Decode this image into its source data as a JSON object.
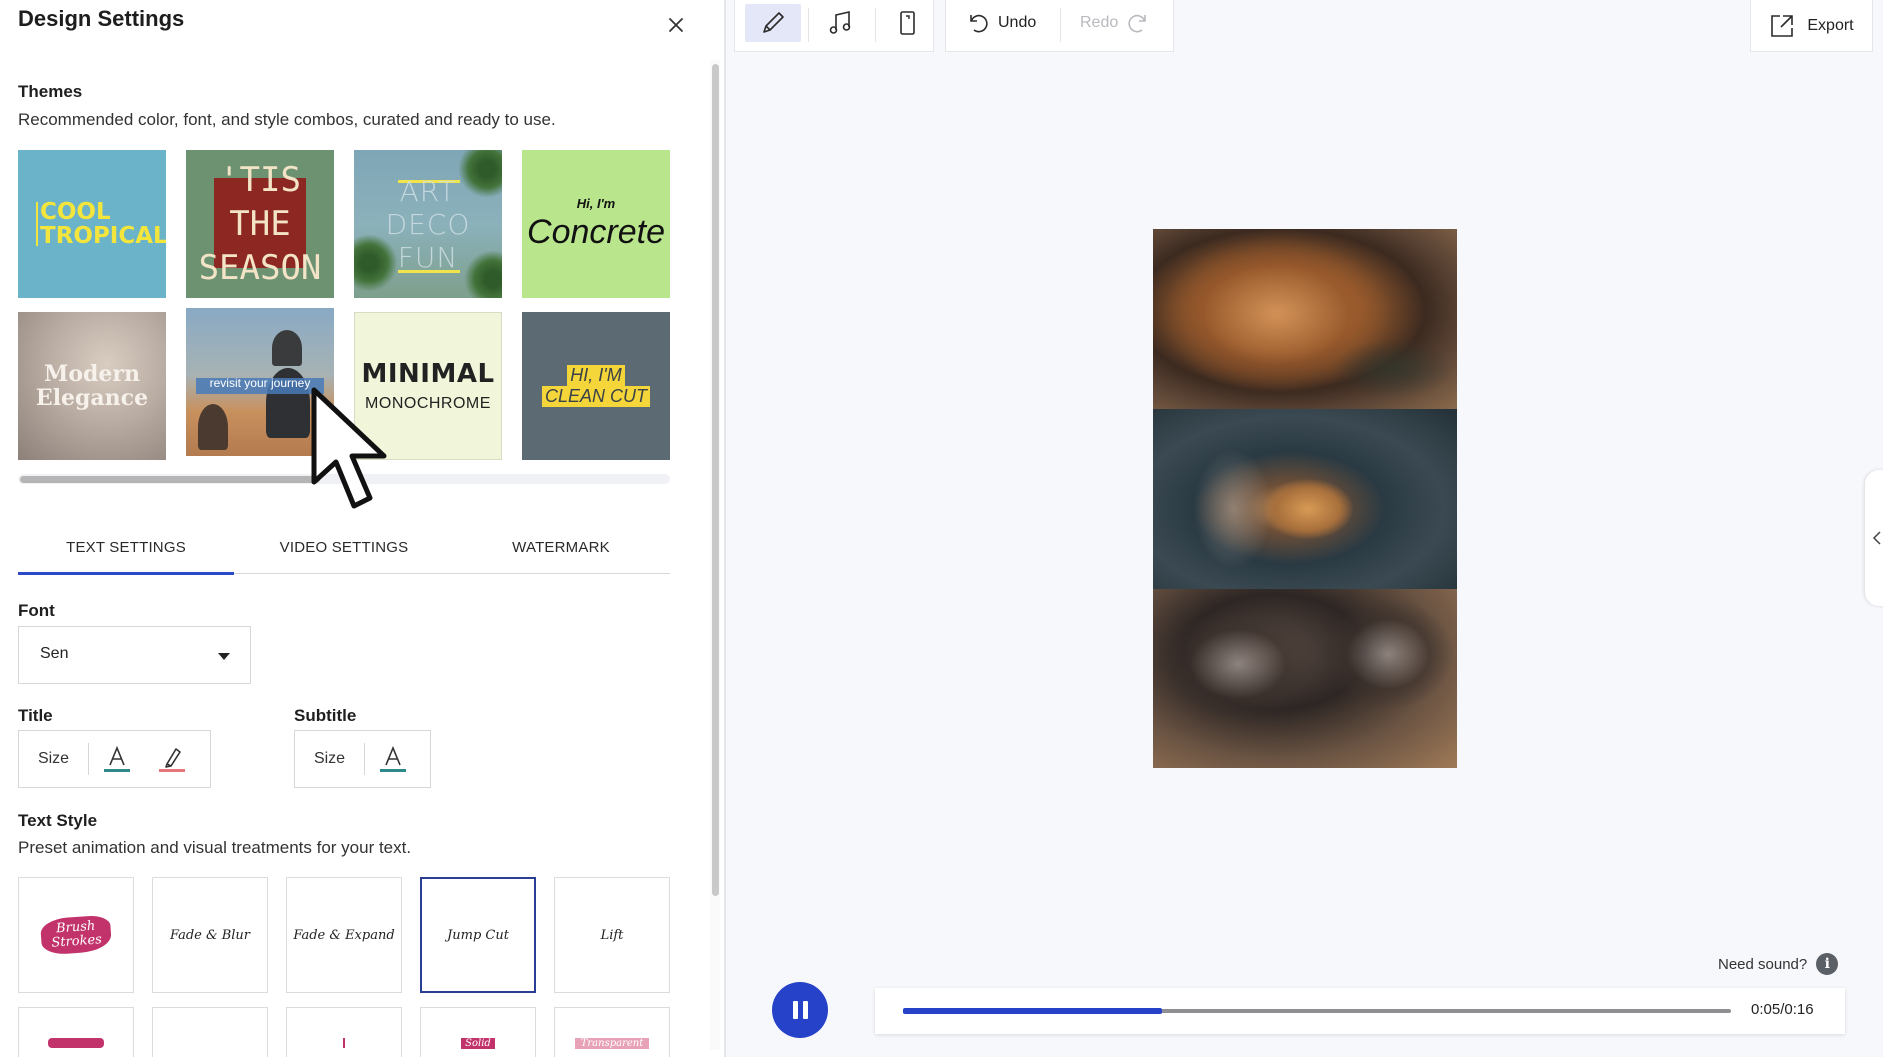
{
  "panel": {
    "title": "Design Settings",
    "themes_title": "Themes",
    "themes_desc": "Recommended color, font, and style combos, curated and ready to use.",
    "themes": [
      {
        "id": "cool-tropical",
        "label": "COOL\nTROPICAL"
      },
      {
        "id": "tis-the-season",
        "label": "'TIS THE\nSEASON"
      },
      {
        "id": "art-deco-fun",
        "label": "ART\nDECO\nFUN"
      },
      {
        "id": "concrete",
        "small": "Hi, I'm",
        "big": "Concrete"
      },
      {
        "id": "modern-elegance",
        "label": "Modern\nElegance"
      },
      {
        "id": "revisit",
        "label": "revisit your journey"
      },
      {
        "id": "minimal-monochrome",
        "big": "MINIMAL",
        "small": "MONOCHROME"
      },
      {
        "id": "clean-cut",
        "line1": "HI, I'M",
        "line2": "CLEAN CUT"
      }
    ],
    "tabs": [
      {
        "label": "TEXT SETTINGS",
        "active": true
      },
      {
        "label": "VIDEO SETTINGS",
        "active": false
      },
      {
        "label": "WATERMARK",
        "active": false
      }
    ],
    "font": {
      "label": "Font",
      "value": "Sen"
    },
    "title_group": {
      "label": "Title",
      "size_label": "Size"
    },
    "subtitle_group": {
      "label": "Subtitle",
      "size_label": "Size"
    },
    "text_style": {
      "title": "Text Style",
      "desc": "Preset animation and visual treatments for your text.",
      "styles": [
        "Brush\nStrokes",
        "Fade & Blur",
        "Fade & Expand",
        "Jump Cut",
        "Lift"
      ],
      "selected": "Jump Cut",
      "partial_styles": [
        "",
        "",
        "",
        "Solid",
        "Transparent"
      ]
    }
  },
  "toolbar": {
    "undo": "Undo",
    "redo": "Redo",
    "export": "Export",
    "tools": [
      "pencil-icon",
      "music-note-icon",
      "phone-layout-icon"
    ]
  },
  "playback": {
    "need_sound": "Need sound?",
    "info_glyph": "i",
    "time": "0:05/0:16",
    "progress": 0.3125
  },
  "colors": {
    "accent": "#2542c9",
    "title_underline": "#2e8a8a",
    "highlight_underline": "#e8767a"
  }
}
